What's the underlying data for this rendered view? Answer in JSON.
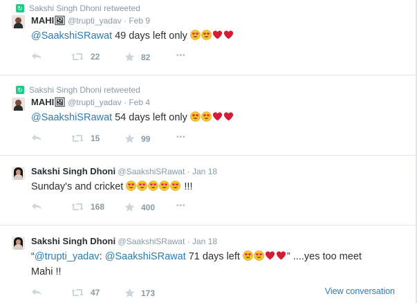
{
  "tweets": [
    {
      "retweet_context": "Sakshi Singh Dhoni retweeted",
      "fullname": "MAHI🖼",
      "username": "@trupti_yadav",
      "sep": "·",
      "date": "Feb 9",
      "mention": "@SaakshiSRawat",
      "text": " 49 days left only ",
      "emojis": [
        "heart-eyes",
        "heart-eyes",
        "red-heart",
        "red-heart"
      ],
      "retweets": "22",
      "favorites": "82"
    },
    {
      "retweet_context": "Sakshi Singh Dhoni retweeted",
      "fullname": "MAHI🖼",
      "username": "@trupti_yadav",
      "sep": "·",
      "date": "Feb 4",
      "mention": "@SaakshiSRawat",
      "text": " 54 days left only ",
      "emojis": [
        "heart-eyes",
        "heart-eyes",
        "red-heart",
        "red-heart"
      ],
      "retweets": "15",
      "favorites": "99"
    },
    {
      "fullname": "Sakshi Singh Dhoni",
      "username": "@SaakshiSRawat",
      "sep": "·",
      "date": "Jan 18",
      "text": "Sunday's and cricket ",
      "emojis": [
        "heart-eyes",
        "heart-eyes",
        "heart-eyes",
        "heart-eyes",
        "heart-eyes"
      ],
      "text_after": " !!!",
      "retweets": "168",
      "favorites": "400"
    },
    {
      "fullname": "Sakshi Singh Dhoni",
      "username": "@SaakshiSRawat",
      "sep": "·",
      "date": "Jan 18",
      "quote_open": "“",
      "mention1": "@trupti_yadav",
      "colon": ": ",
      "mention2": "@SaakshiSRawat",
      "text": " 71 days left ",
      "emojis": [
        "heart-eyes",
        "heart-eyes",
        "red-heart",
        "red-heart"
      ],
      "text_after": "” ....yes too meet",
      "line2": "Mahi !!",
      "retweets": "47",
      "favorites": "173",
      "view_conversation": "View conversation"
    }
  ],
  "more_label": "•••",
  "icons": {
    "reply": "reply-arrow-icon",
    "retweet": "retweet-icon",
    "favorite": "star-icon",
    "more": "more-dots-icon"
  },
  "colors": {
    "link": "#2b7bb9",
    "muted": "#8899a6",
    "retweet_green": "#19cf86"
  }
}
